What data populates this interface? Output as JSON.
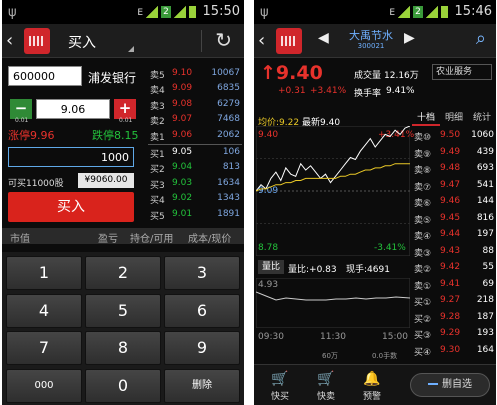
{
  "left": {
    "status": {
      "time": "15:50",
      "e_badge": "E",
      "badge": "2"
    },
    "title": "买入",
    "account": "600000",
    "stock_name": "浦发银行",
    "price_value": "9.06",
    "minus_step": "0.01",
    "plus_step": "0.01",
    "limit_up": "涨停9.96",
    "limit_down": "跌停8.15",
    "quantity": "1000",
    "max_buy": "可买11000股",
    "amount": "¥9060.00",
    "buy_button": "买入",
    "orderbook": [
      {
        "label": "卖5",
        "price": "9.10",
        "vol": "10067",
        "color": "red"
      },
      {
        "label": "卖4",
        "price": "9.09",
        "vol": "6835",
        "color": "red"
      },
      {
        "label": "卖3",
        "price": "9.08",
        "vol": "6279",
        "color": "red"
      },
      {
        "label": "卖2",
        "price": "9.07",
        "vol": "7468",
        "color": "red"
      },
      {
        "label": "卖1",
        "price": "9.06",
        "vol": "2062",
        "color": "red"
      },
      {
        "label": "买1",
        "price": "9.05",
        "vol": "106",
        "color": "white"
      },
      {
        "label": "买2",
        "price": "9.04",
        "vol": "813",
        "color": "green"
      },
      {
        "label": "买3",
        "price": "9.03",
        "vol": "1634",
        "color": "green"
      },
      {
        "label": "买4",
        "price": "9.02",
        "vol": "1343",
        "color": "green"
      },
      {
        "label": "买5",
        "price": "9.01",
        "vol": "1891",
        "color": "green"
      }
    ],
    "table_header": {
      "market_value": "市值",
      "pnl": "盈亏",
      "position": "持仓/可用",
      "cost": "成本/现价"
    },
    "keys": [
      "1",
      "2",
      "3",
      "4",
      "5",
      "6",
      "7",
      "8",
      "9",
      "000",
      "0",
      "删除"
    ]
  },
  "right": {
    "status": {
      "time": "15:46",
      "e_badge": "E",
      "badge": "2"
    },
    "stock_name": "大禹节水",
    "stock_code": "300021",
    "price": "9.40",
    "change": "+0.31",
    "change_pct": "+3.41%",
    "volume_label": "成交量",
    "volume": "12.16万",
    "turnover_label": "换手率",
    "turnover": "9.41%",
    "industry": "农业服务",
    "avg_label": "均价:9.22",
    "latest_label": "最新9.40",
    "y_top": "9.40",
    "y_top_pct": "+3.41%",
    "y_mid": "9.09",
    "y_bottom": "8.78",
    "y_bottom_pct": "-3.41%",
    "vol_tab": "量比",
    "vol_ratio": "量比:+0.83",
    "cur_hand": "现手:4691",
    "vol_axis": "4.93",
    "times": [
      "09:30",
      "11:30",
      "15:00"
    ],
    "cut_axis_text": "60万",
    "cut_axis_text_right": "0.0手数",
    "tabs": [
      "十档",
      "明细",
      "统计"
    ],
    "depth": [
      {
        "label": "卖⑩",
        "price": "9.50",
        "vol": "1060"
      },
      {
        "label": "卖⑨",
        "price": "9.49",
        "vol": "439"
      },
      {
        "label": "卖⑧",
        "price": "9.48",
        "vol": "693"
      },
      {
        "label": "卖⑦",
        "price": "9.47",
        "vol": "541"
      },
      {
        "label": "卖⑥",
        "price": "9.46",
        "vol": "144"
      },
      {
        "label": "卖⑤",
        "price": "9.45",
        "vol": "816"
      },
      {
        "label": "卖④",
        "price": "9.44",
        "vol": "197"
      },
      {
        "label": "卖③",
        "price": "9.43",
        "vol": "88"
      },
      {
        "label": "卖②",
        "price": "9.42",
        "vol": "55"
      },
      {
        "label": "卖①",
        "price": "9.41",
        "vol": "69"
      },
      {
        "label": "买①",
        "price": "9.27",
        "vol": "218"
      },
      {
        "label": "买②",
        "price": "9.28",
        "vol": "187"
      },
      {
        "label": "买③",
        "price": "9.29",
        "vol": "193"
      },
      {
        "label": "买④",
        "price": "9.30",
        "vol": "164"
      }
    ],
    "bottom": {
      "quick_buy": "快买",
      "quick_sell": "快卖",
      "alert": "预警",
      "remove_fav": "删自选"
    },
    "chart_data": {
      "type": "line",
      "series": [
        {
          "name": "",
          "values": [
            9.09,
            9.12,
            9.1,
            9.15,
            9.18,
            9.14,
            9.2,
            9.17,
            9.16,
            9.22,
            9.19,
            9.21,
            9.18,
            9.15,
            9.17,
            9.13,
            9.16,
            9.19,
            9.22,
            9.25,
            9.24,
            9.28,
            9.31,
            9.34,
            9.3,
            9.33,
            9.36,
            9.35,
            9.38,
            9.36,
            9.39,
            9.4
          ]
        },
        {
          "name": "",
          "values": [
            9.09,
            9.1,
            9.1,
            9.11,
            9.12,
            9.12,
            9.13,
            9.13,
            9.14,
            9.14,
            9.15,
            9.15,
            9.15,
            9.15,
            9.15,
            9.15,
            9.15,
            9.16,
            9.16,
            9.17,
            9.17,
            9.18,
            9.19,
            9.19,
            9.2,
            9.2,
            9.21,
            9.21,
            9.22,
            9.22,
            9.22,
            9.22
          ]
        }
      ],
      "ylim": [
        8.78,
        9.4
      ]
    }
  }
}
